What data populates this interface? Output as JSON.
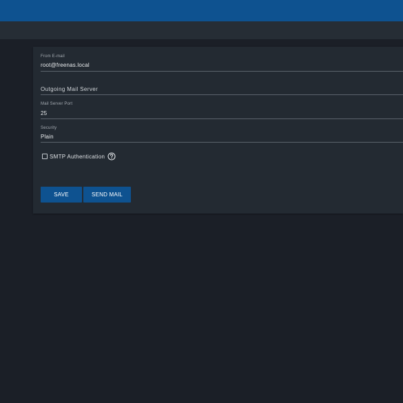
{
  "form": {
    "from_email": {
      "label": "From E-mail",
      "value": "root@freenas.local"
    },
    "outgoing_mail_server": {
      "placeholder": "Outgoing Mail Server",
      "value": ""
    },
    "mail_server_port": {
      "label": "Mail Server Port",
      "value": "25"
    },
    "security": {
      "label": "Security",
      "value": "Plain"
    },
    "smtp_auth": {
      "label": "SMTP Authentication",
      "checked": false
    }
  },
  "actions": {
    "save_label": "SAVE",
    "send_mail_label": "SEND MAIL"
  },
  "colors": {
    "accent": "#0e5290",
    "background": "#1b1f27",
    "card": "#232a32"
  }
}
